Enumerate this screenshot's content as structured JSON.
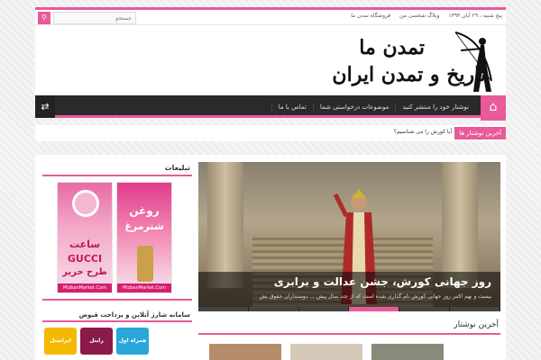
{
  "topbar": {
    "search_placeholder": "جستجو",
    "date": "پنج شنبه ، ۲۹ آبان ۱۳۹۳",
    "links": [
      "وبلاگ شخصی من",
      "فروشگاه تمدن ما"
    ]
  },
  "header": {
    "logo_title": "تمدن ما",
    "logo_subtitle": "تاریخ و تمدن ایران"
  },
  "nav": {
    "items": [
      "نوشتار خود را منتشر کنید",
      "موضوعات درخواستی شما",
      "تماس با ما"
    ]
  },
  "breaking": {
    "tag": "آخرین نوشتار ها",
    "text": "آیا کورش را می شناسیم؟"
  },
  "slider": {
    "title": "روز جهانی کورش، جشن عدالت و برابری",
    "excerpt": "بیست و نهم اکتبر روز جهانی کورش نام گذاری شده است که از چند سال پیش ... دوستداران حقوق بش"
  },
  "sidebar": {
    "ads_title": "تبلیغات",
    "ad1": {
      "line1": "روغن",
      "line2": "شترمرغ",
      "footer": "MizbanMarket.Com"
    },
    "ad2": {
      "line1": "ساعت",
      "line2": "GUCCI",
      "line3": "طرح حریر",
      "footer": "MizbanMarket.Com"
    },
    "charge_title": "سامانه شارژ آنلاین و پرداخت قبوض",
    "operators": [
      "ایرانسل",
      "رایتل",
      "همراه اول"
    ]
  },
  "latest": {
    "title": "آخرین نوشتار"
  },
  "colors": {
    "accent": "#e85a9a",
    "nav_bg": "#2a2a2a"
  }
}
